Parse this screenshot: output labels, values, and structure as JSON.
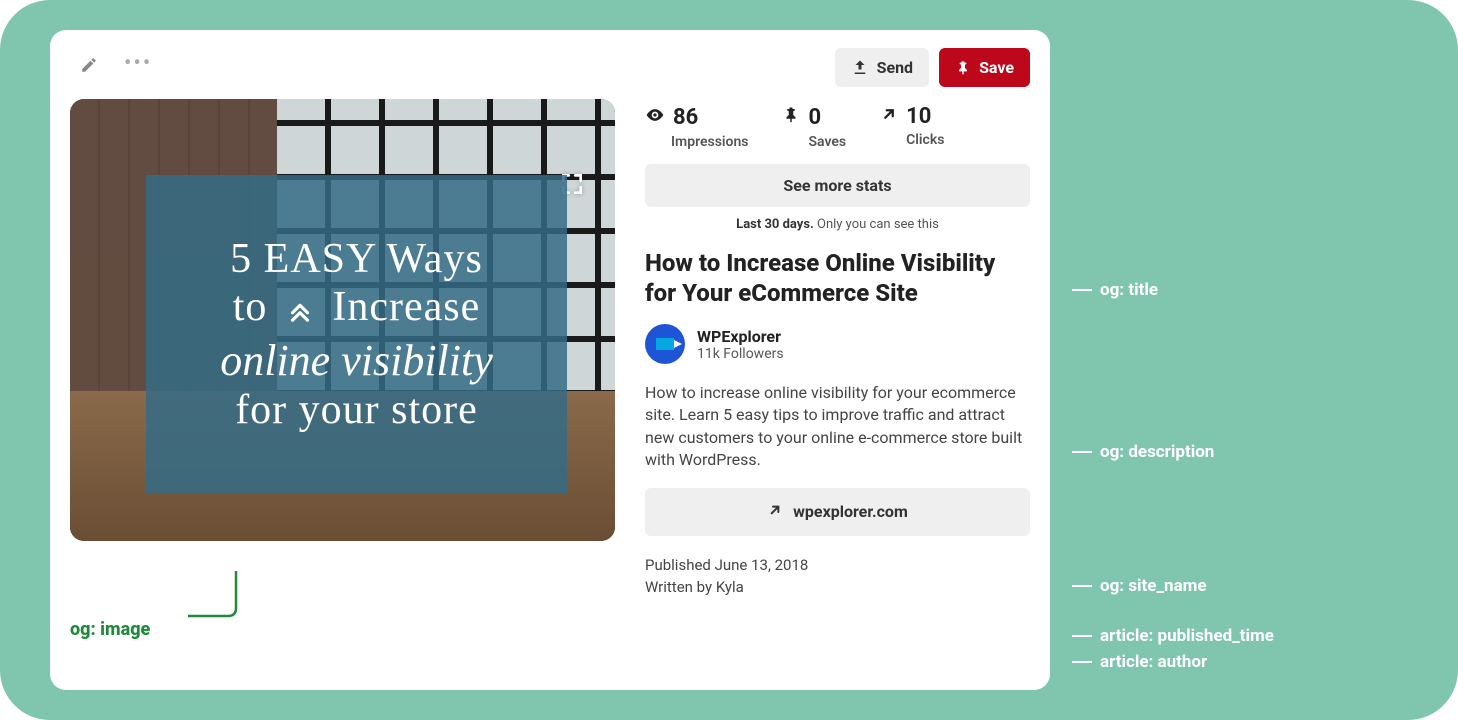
{
  "toolbar": {
    "send_label": "Send",
    "save_label": "Save"
  },
  "image_overlay": {
    "line1": "5 EASY Ways",
    "line2a": "to",
    "line2b": "Increase",
    "line3": "online visibility",
    "line4": "for your store"
  },
  "stats": {
    "impressions": {
      "value": "86",
      "label": "Impressions"
    },
    "saves": {
      "value": "0",
      "label": "Saves"
    },
    "clicks": {
      "value": "10",
      "label": "Clicks"
    },
    "see_more": "See more stats",
    "last30_bold": "Last 30 days.",
    "last30_rest": " Only you can see this"
  },
  "pin": {
    "title": "How to Increase Online Visibility for Your eCommerce Site",
    "source_name": "WPExplorer",
    "source_followers": "11k Followers",
    "description": "How to increase online visibility for your ecommerce site. Learn 5 easy tips to improve traffic and attract new customers to your online e-commerce store built with WordPress.",
    "site_name": "wpexplorer.com",
    "published": "Published June 13, 2018",
    "author": "Written by Kyla"
  },
  "annotations": {
    "image": "og: image",
    "title": "og: title",
    "description": "og: description",
    "site_name": "og: site_name",
    "published_time": "article: published_time",
    "author": "article: author"
  }
}
